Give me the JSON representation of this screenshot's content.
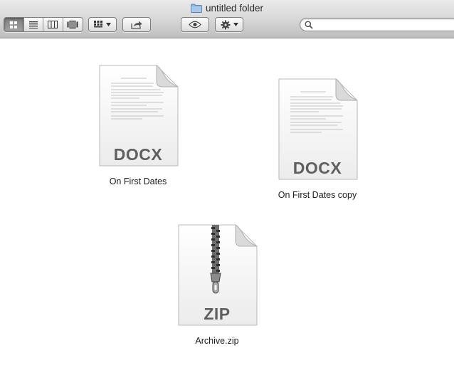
{
  "window": {
    "title": "untitled folder",
    "folder_icon": "folder-icon"
  },
  "toolbar": {
    "view_modes": [
      "icon-view",
      "list-view",
      "column-view",
      "cover-flow-view"
    ],
    "active_view": "icon-view",
    "arrange_icon": "arrange-grid-icon",
    "share_icon": "share-icon",
    "quick_look_icon": "eye-icon",
    "action_icon": "gear-icon",
    "search_icon": "search-icon",
    "search_value": ""
  },
  "files": [
    {
      "name": "On First Dates",
      "type_label": "DOCX",
      "icon": "docx-file-icon"
    },
    {
      "name": "On First Dates copy",
      "type_label": "DOCX",
      "icon": "docx-file-icon"
    },
    {
      "name": "Archive.zip",
      "type_label": "ZIP",
      "icon": "zip-file-icon"
    }
  ],
  "colors": {
    "toolbar_top": "#eaeaea",
    "toolbar_bottom": "#bdbdbd",
    "folder_blue": "#8fb4dd",
    "type_label": "#5f5f5f"
  }
}
